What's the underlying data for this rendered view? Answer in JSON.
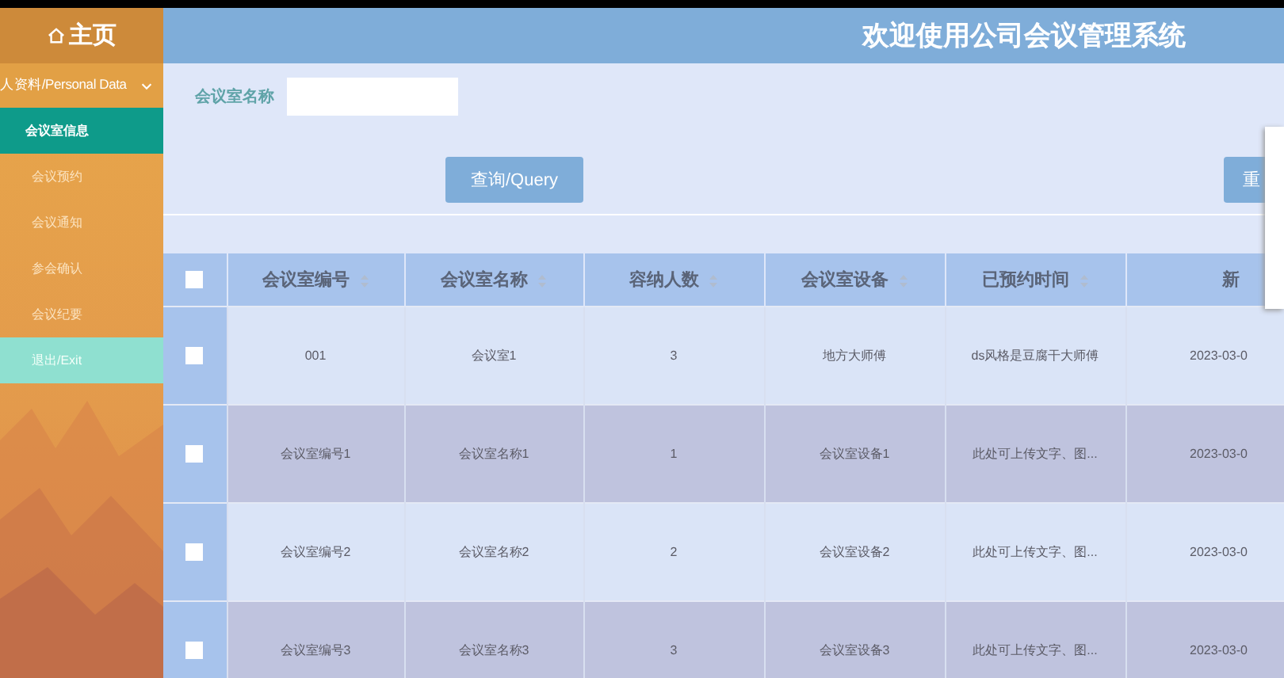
{
  "sidebar": {
    "home": "主页",
    "section": {
      "label": "人资料/Personal Data",
      "expanded": true
    },
    "items": [
      {
        "label": "会议室信息",
        "selected": true,
        "kind": "nav"
      },
      {
        "label": "会议预约",
        "selected": false,
        "kind": "nav"
      },
      {
        "label": "会议通知",
        "selected": false,
        "kind": "nav"
      },
      {
        "label": "参会确认",
        "selected": false,
        "kind": "nav"
      },
      {
        "label": "会议纪要",
        "selected": false,
        "kind": "nav"
      },
      {
        "label": "退出/Exit",
        "selected": false,
        "kind": "exit"
      }
    ]
  },
  "header": {
    "title": "欢迎使用公司会议管理系统"
  },
  "search": {
    "label": "会议室名称",
    "query_button": "查询/Query",
    "reset_button": "重"
  },
  "table": {
    "all_checked": false,
    "columns": [
      "会议室编号",
      "会议室名称",
      "容纳人数",
      "会议室设备",
      "已预约时间",
      "新"
    ],
    "rows": [
      {
        "checked": false,
        "cells": [
          "001",
          "会议室1",
          "3",
          "地方大师傅",
          "ds风格是豆腐干大师傅",
          "2023-03-0"
        ]
      },
      {
        "checked": false,
        "cells": [
          "会议室编号1",
          "会议室名称1",
          "1",
          "会议室设备1",
          "此处可上传文字、图...",
          "2023-03-0"
        ]
      },
      {
        "checked": false,
        "cells": [
          "会议室编号2",
          "会议室名称2",
          "2",
          "会议室设备2",
          "此处可上传文字、图...",
          "2023-03-0"
        ]
      },
      {
        "checked": false,
        "cells": [
          "会议室编号3",
          "会议室名称3",
          "3",
          "会议室设备3",
          "此处可上传文字、图...",
          "2023-03-0"
        ]
      }
    ]
  }
}
